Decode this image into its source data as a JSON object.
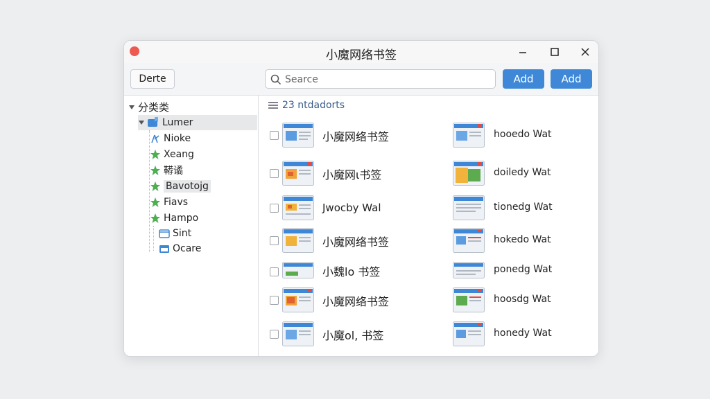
{
  "window": {
    "title": "小魔网络书签"
  },
  "toolbar": {
    "delete_label": "Derte",
    "search_placeholder": "Searce",
    "add_label_1": "Add",
    "add_label_2": "Add"
  },
  "sidebar": {
    "root_label": "分类类",
    "items": [
      {
        "label": "Lumer",
        "icon": "bookmark-folder-icon"
      },
      {
        "label": "Nioke",
        "icon": "leaf-icon"
      },
      {
        "label": "Xeang",
        "icon": "star-icon"
      },
      {
        "label": "鞯谲",
        "icon": "star-icon"
      },
      {
        "label": "Bavotojg",
        "icon": "star-icon"
      },
      {
        "label": "Fiavs",
        "icon": "star-icon"
      },
      {
        "label": "Hampo",
        "icon": "star-icon"
      },
      {
        "label": "Sint",
        "icon": "folder-icon"
      },
      {
        "label": "Ocare",
        "icon": "folder-icon"
      }
    ]
  },
  "main": {
    "count_label": "23 ntdadorts",
    "rows": [
      {
        "left_text": "小魔网络书签",
        "right_text": "hooedo Wat"
      },
      {
        "left_text": "小魔网ι书签",
        "right_text": "doiledy Wat"
      },
      {
        "left_text": "Jwocby Wal",
        "right_text": "tionedg Wat"
      },
      {
        "left_text": "小魔网络书签",
        "right_text": "hokedo Wat"
      },
      {
        "left_text": "小魏lo 书签",
        "right_text": "ponedg Wat"
      },
      {
        "left_text": "小魔网络书签",
        "right_text": "hoosdg Wat"
      },
      {
        "left_text": "小魔ol, 书签",
        "right_text": "honedy Wat"
      }
    ]
  },
  "colors": {
    "accent": "#3f88d8",
    "close_dot": "#ee5a4f",
    "star_green": "#4caf50",
    "folder_blue": "#3e86d6"
  }
}
